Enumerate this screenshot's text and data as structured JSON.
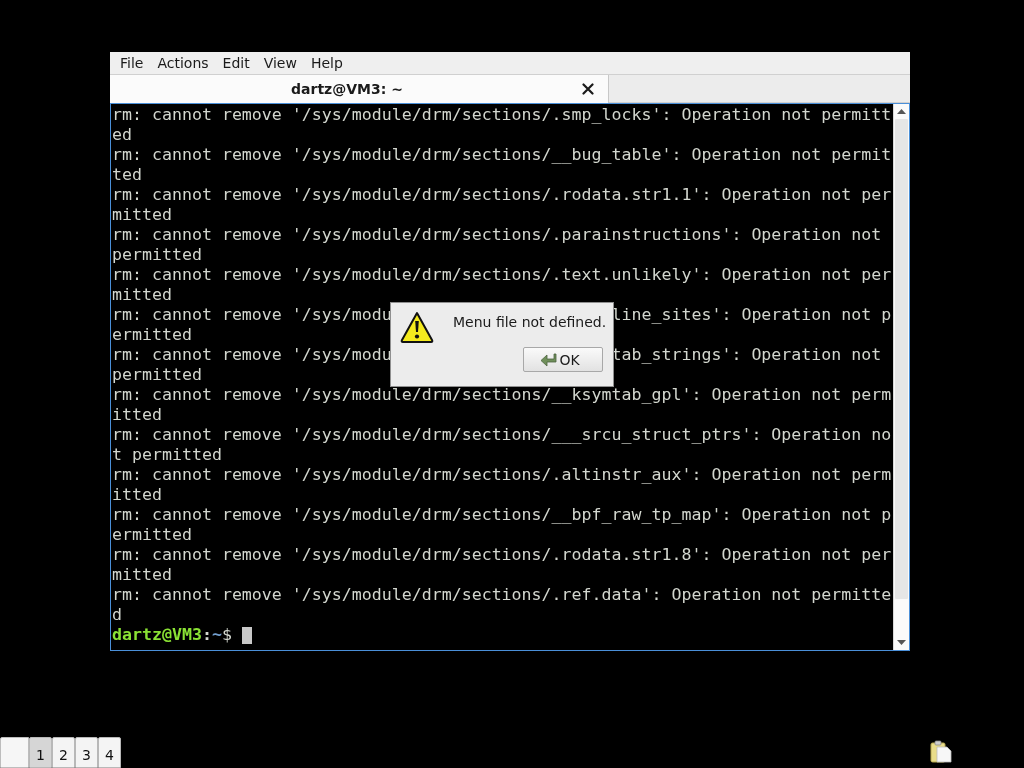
{
  "menu_bar": {
    "items": [
      "File",
      "Actions",
      "Edit",
      "View",
      "Help"
    ]
  },
  "tabs": [
    {
      "title": "dartz@VM3: ~",
      "selected": true
    }
  ],
  "terminal": {
    "lines": [
      {
        "kind": "text",
        "text": "rm: cannot remove '/sys/module/drm/sections/.smp_locks': Operation not permitt"
      },
      {
        "kind": "text",
        "text": "ed"
      },
      {
        "kind": "text",
        "text": "rm: cannot remove '/sys/module/drm/sections/__bug_table': Operation not permit"
      },
      {
        "kind": "text",
        "text": "ted"
      },
      {
        "kind": "text",
        "text": "rm: cannot remove '/sys/module/drm/sections/.rodata.str1.1': Operation not per"
      },
      {
        "kind": "text",
        "text": "mitted"
      },
      {
        "kind": "text",
        "text": "rm: cannot remove '/sys/module/drm/sections/.parainstructions': Operation not"
      },
      {
        "kind": "text",
        "text": "permitted"
      },
      {
        "kind": "text",
        "text": "rm: cannot remove '/sys/module/drm/sections/.text.unlikely': Operation not per"
      },
      {
        "kind": "text",
        "text": "mitted"
      },
      {
        "kind": "split",
        "left": "rm: cannot remove '/sys/modu",
        "right": "line_sites': Operation not p"
      },
      {
        "kind": "text",
        "text": "ermitted"
      },
      {
        "kind": "split",
        "left": "rm: cannot remove '/sys/modu",
        "right": "tab_strings': Operation not"
      },
      {
        "kind": "text",
        "text": "permitted"
      },
      {
        "kind": "text",
        "text": "rm: cannot remove '/sys/module/drm/sections/__ksymtab_gpl': Operation not perm"
      },
      {
        "kind": "text",
        "text": "itted"
      },
      {
        "kind": "text",
        "text": "rm: cannot remove '/sys/module/drm/sections/___srcu_struct_ptrs': Operation no"
      },
      {
        "kind": "text",
        "text": "t permitted"
      },
      {
        "kind": "text",
        "text": "rm: cannot remove '/sys/module/drm/sections/.altinstr_aux': Operation not perm"
      },
      {
        "kind": "text",
        "text": "itted"
      },
      {
        "kind": "text",
        "text": "rm: cannot remove '/sys/module/drm/sections/__bpf_raw_tp_map': Operation not p"
      },
      {
        "kind": "text",
        "text": "ermitted"
      },
      {
        "kind": "text",
        "text": "rm: cannot remove '/sys/module/drm/sections/.rodata.str1.8': Operation not per"
      },
      {
        "kind": "text",
        "text": "mitted"
      },
      {
        "kind": "text",
        "text": "rm: cannot remove '/sys/module/drm/sections/.ref.data': Operation not permitte"
      },
      {
        "kind": "text",
        "text": "d"
      }
    ],
    "prompt": {
      "user_host": "dartz@VM3",
      "separator": ":",
      "path": "~",
      "symbol": "$"
    }
  },
  "dialog": {
    "message": "Menu file not defined.",
    "button": "OK"
  },
  "taskbar": {
    "workspaces": [
      {
        "label": "1",
        "selected": true
      },
      {
        "label": "2",
        "selected": false
      },
      {
        "label": "3",
        "selected": false
      },
      {
        "label": "4",
        "selected": false
      }
    ]
  }
}
